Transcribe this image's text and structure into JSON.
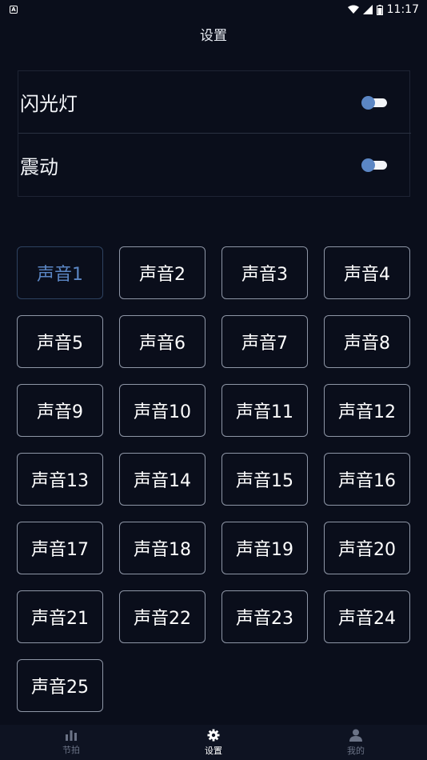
{
  "status_bar": {
    "time": "11:17"
  },
  "header": {
    "title": "设置"
  },
  "settings": {
    "flashlight_label": "闪光灯",
    "vibration_label": "震动"
  },
  "sounds": [
    "声音1",
    "声音2",
    "声音3",
    "声音4",
    "声音5",
    "声音6",
    "声音7",
    "声音8",
    "声音9",
    "声音10",
    "声音11",
    "声音12",
    "声音13",
    "声音14",
    "声音15",
    "声音16",
    "声音17",
    "声音18",
    "声音19",
    "声音20",
    "声音21",
    "声音22",
    "声音23",
    "声音24",
    "声音25"
  ],
  "selected_sound": "声音1",
  "bottom_nav": {
    "items": [
      {
        "label": "节拍",
        "icon": "bar-chart-icon"
      },
      {
        "label": "设置",
        "icon": "gear-icon"
      },
      {
        "label": "我的",
        "icon": "person-icon"
      }
    ],
    "active": "设置"
  },
  "colors": {
    "background": "#0a0e1b",
    "accent": "#5b86c4",
    "border": "#8e96a6"
  }
}
